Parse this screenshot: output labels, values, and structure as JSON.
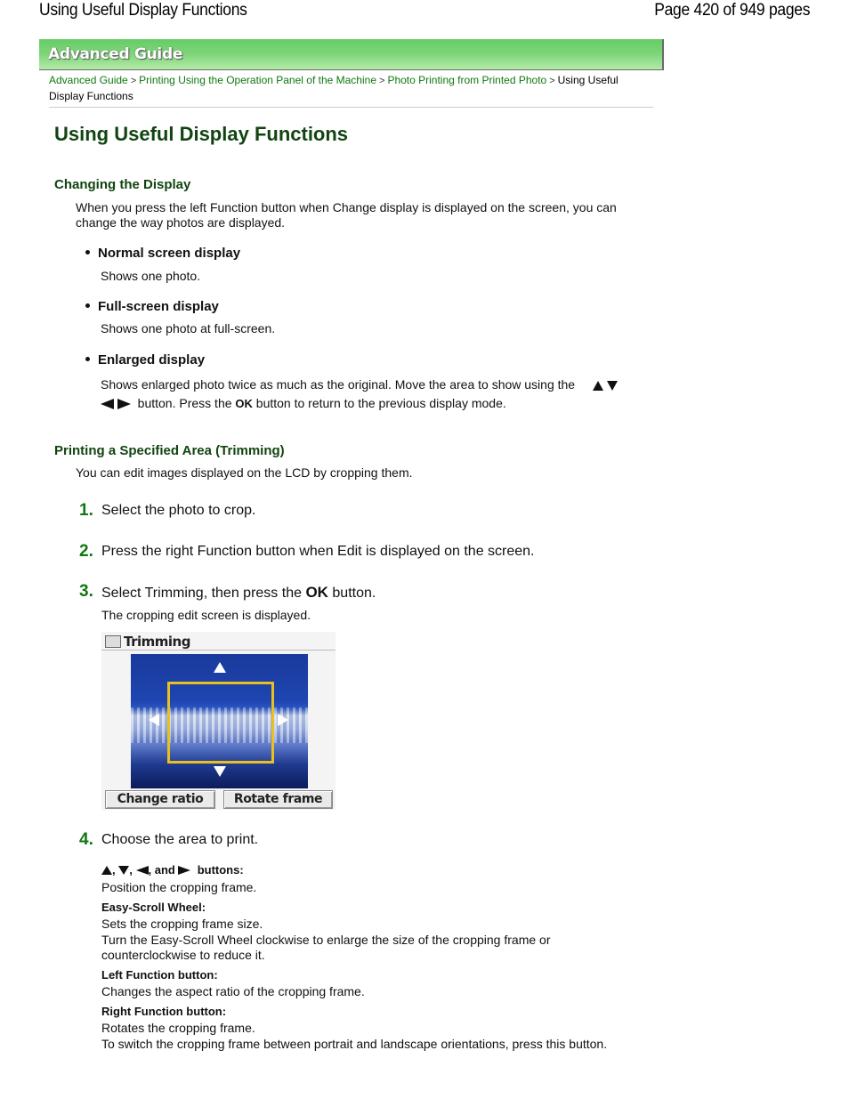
{
  "page_header": {
    "title": "Using Useful Display Functions",
    "page_indicator": "Page 420 of 949 pages"
  },
  "banner": {
    "label": "Advanced Guide"
  },
  "breadcrumb": {
    "items": [
      {
        "label": "Advanced Guide",
        "link": true
      },
      {
        "label": "Printing Using the Operation Panel of the Machine",
        "link": true
      },
      {
        "label": "Photo Printing from Printed Photo",
        "link": true
      },
      {
        "label": "Using Useful Display Functions",
        "link": false
      }
    ],
    "separator": ">"
  },
  "heading": "Using Useful Display Functions",
  "section_display": {
    "title": "Changing the Display",
    "intro_line1": "When you press the left Function button when Change display is displayed on the screen, you can",
    "intro_line2": "change the way photos are displayed.",
    "modes": [
      {
        "title": "Normal screen display",
        "desc": "Shows one photo."
      },
      {
        "title": "Full-screen display",
        "desc": "Shows one photo at full-screen."
      },
      {
        "title": "Enlarged display",
        "desc_part1": "Shows enlarged photo twice as much as the original. Move the area to show using the",
        "desc_part2": "button. Press the",
        "ok": "OK",
        "desc_part3": "button to return to the previous display mode."
      }
    ]
  },
  "section_trimming": {
    "title": "Printing a Specified Area (Trimming)",
    "intro": "You can edit images displayed on the LCD by cropping them.",
    "steps": [
      {
        "num": "1.",
        "text": "Select the photo to crop."
      },
      {
        "num": "2.",
        "text": "Press the right Function button when Edit is displayed on the screen."
      },
      {
        "num": "3.",
        "text_before": "Select Trimming, then press the",
        "ok": "OK",
        "text_after": "button.",
        "note": "The cropping edit screen is displayed."
      },
      {
        "num": "4.",
        "text": "Choose the area to print."
      }
    ],
    "lcd": {
      "title": "Trimming",
      "left_button": "Change ratio",
      "right_button": "Rotate frame"
    },
    "controls": [
      {
        "head_sep1": ",",
        "head_sep2": ",",
        "head_and": ", and",
        "head_suffix": "buttons:",
        "lines": [
          "Position the cropping frame."
        ]
      },
      {
        "head": "Easy-Scroll Wheel:",
        "lines": [
          "Sets the cropping frame size.",
          "Turn the Easy-Scroll Wheel clockwise to enlarge the size of the cropping frame or",
          "counterclockwise to reduce it."
        ]
      },
      {
        "head": "Left Function button:",
        "lines": [
          "Changes the aspect ratio of the cropping frame."
        ]
      },
      {
        "head": "Right Function button:",
        "lines": [
          "Rotates the cropping frame.",
          "To switch the cropping frame between portrait and landscape orientations, press this button."
        ]
      }
    ]
  }
}
